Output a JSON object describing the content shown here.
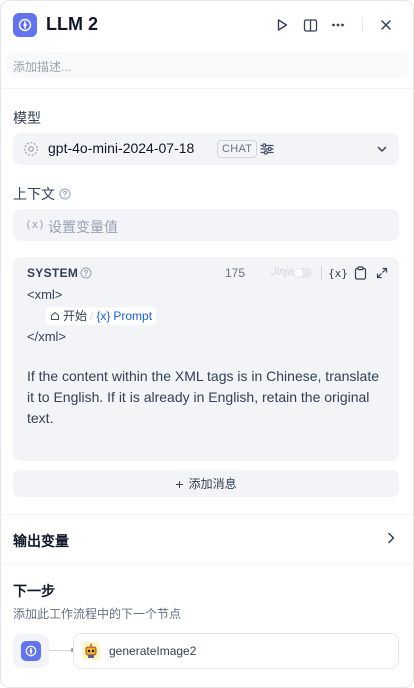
{
  "header": {
    "title": "LLM 2",
    "description_placeholder": "添加描述..."
  },
  "model": {
    "label": "模型",
    "name": "gpt-4o-mini-2024-07-18",
    "mode_badge": "CHAT"
  },
  "context": {
    "label": "上下文",
    "placeholder": "设置变量值",
    "var_icon": "(x)"
  },
  "system_prompt": {
    "role": "SYSTEM",
    "char_count": "175",
    "jinja_label": "Jinja",
    "jinja_enabled": false,
    "var_icon": "{x}",
    "xml_open": "<xml>",
    "xml_close": "</xml>",
    "variable_node": "开始",
    "variable_name": "Prompt",
    "body": "If the content within the XML tags is in Chinese, translate it to English. If it is already in English, retain the original text."
  },
  "add_message": {
    "icon": "+",
    "label": "添加消息"
  },
  "output_vars": {
    "label": "输出变量"
  },
  "next_step": {
    "title": "下一步",
    "subtitle": "添加此工作流程中的下一个节点",
    "next_node_name": "generateImage2"
  },
  "colors": {
    "brand": "#6172f3",
    "variable_blue": "#155eef",
    "panel_bg": "#f2f4f7"
  }
}
